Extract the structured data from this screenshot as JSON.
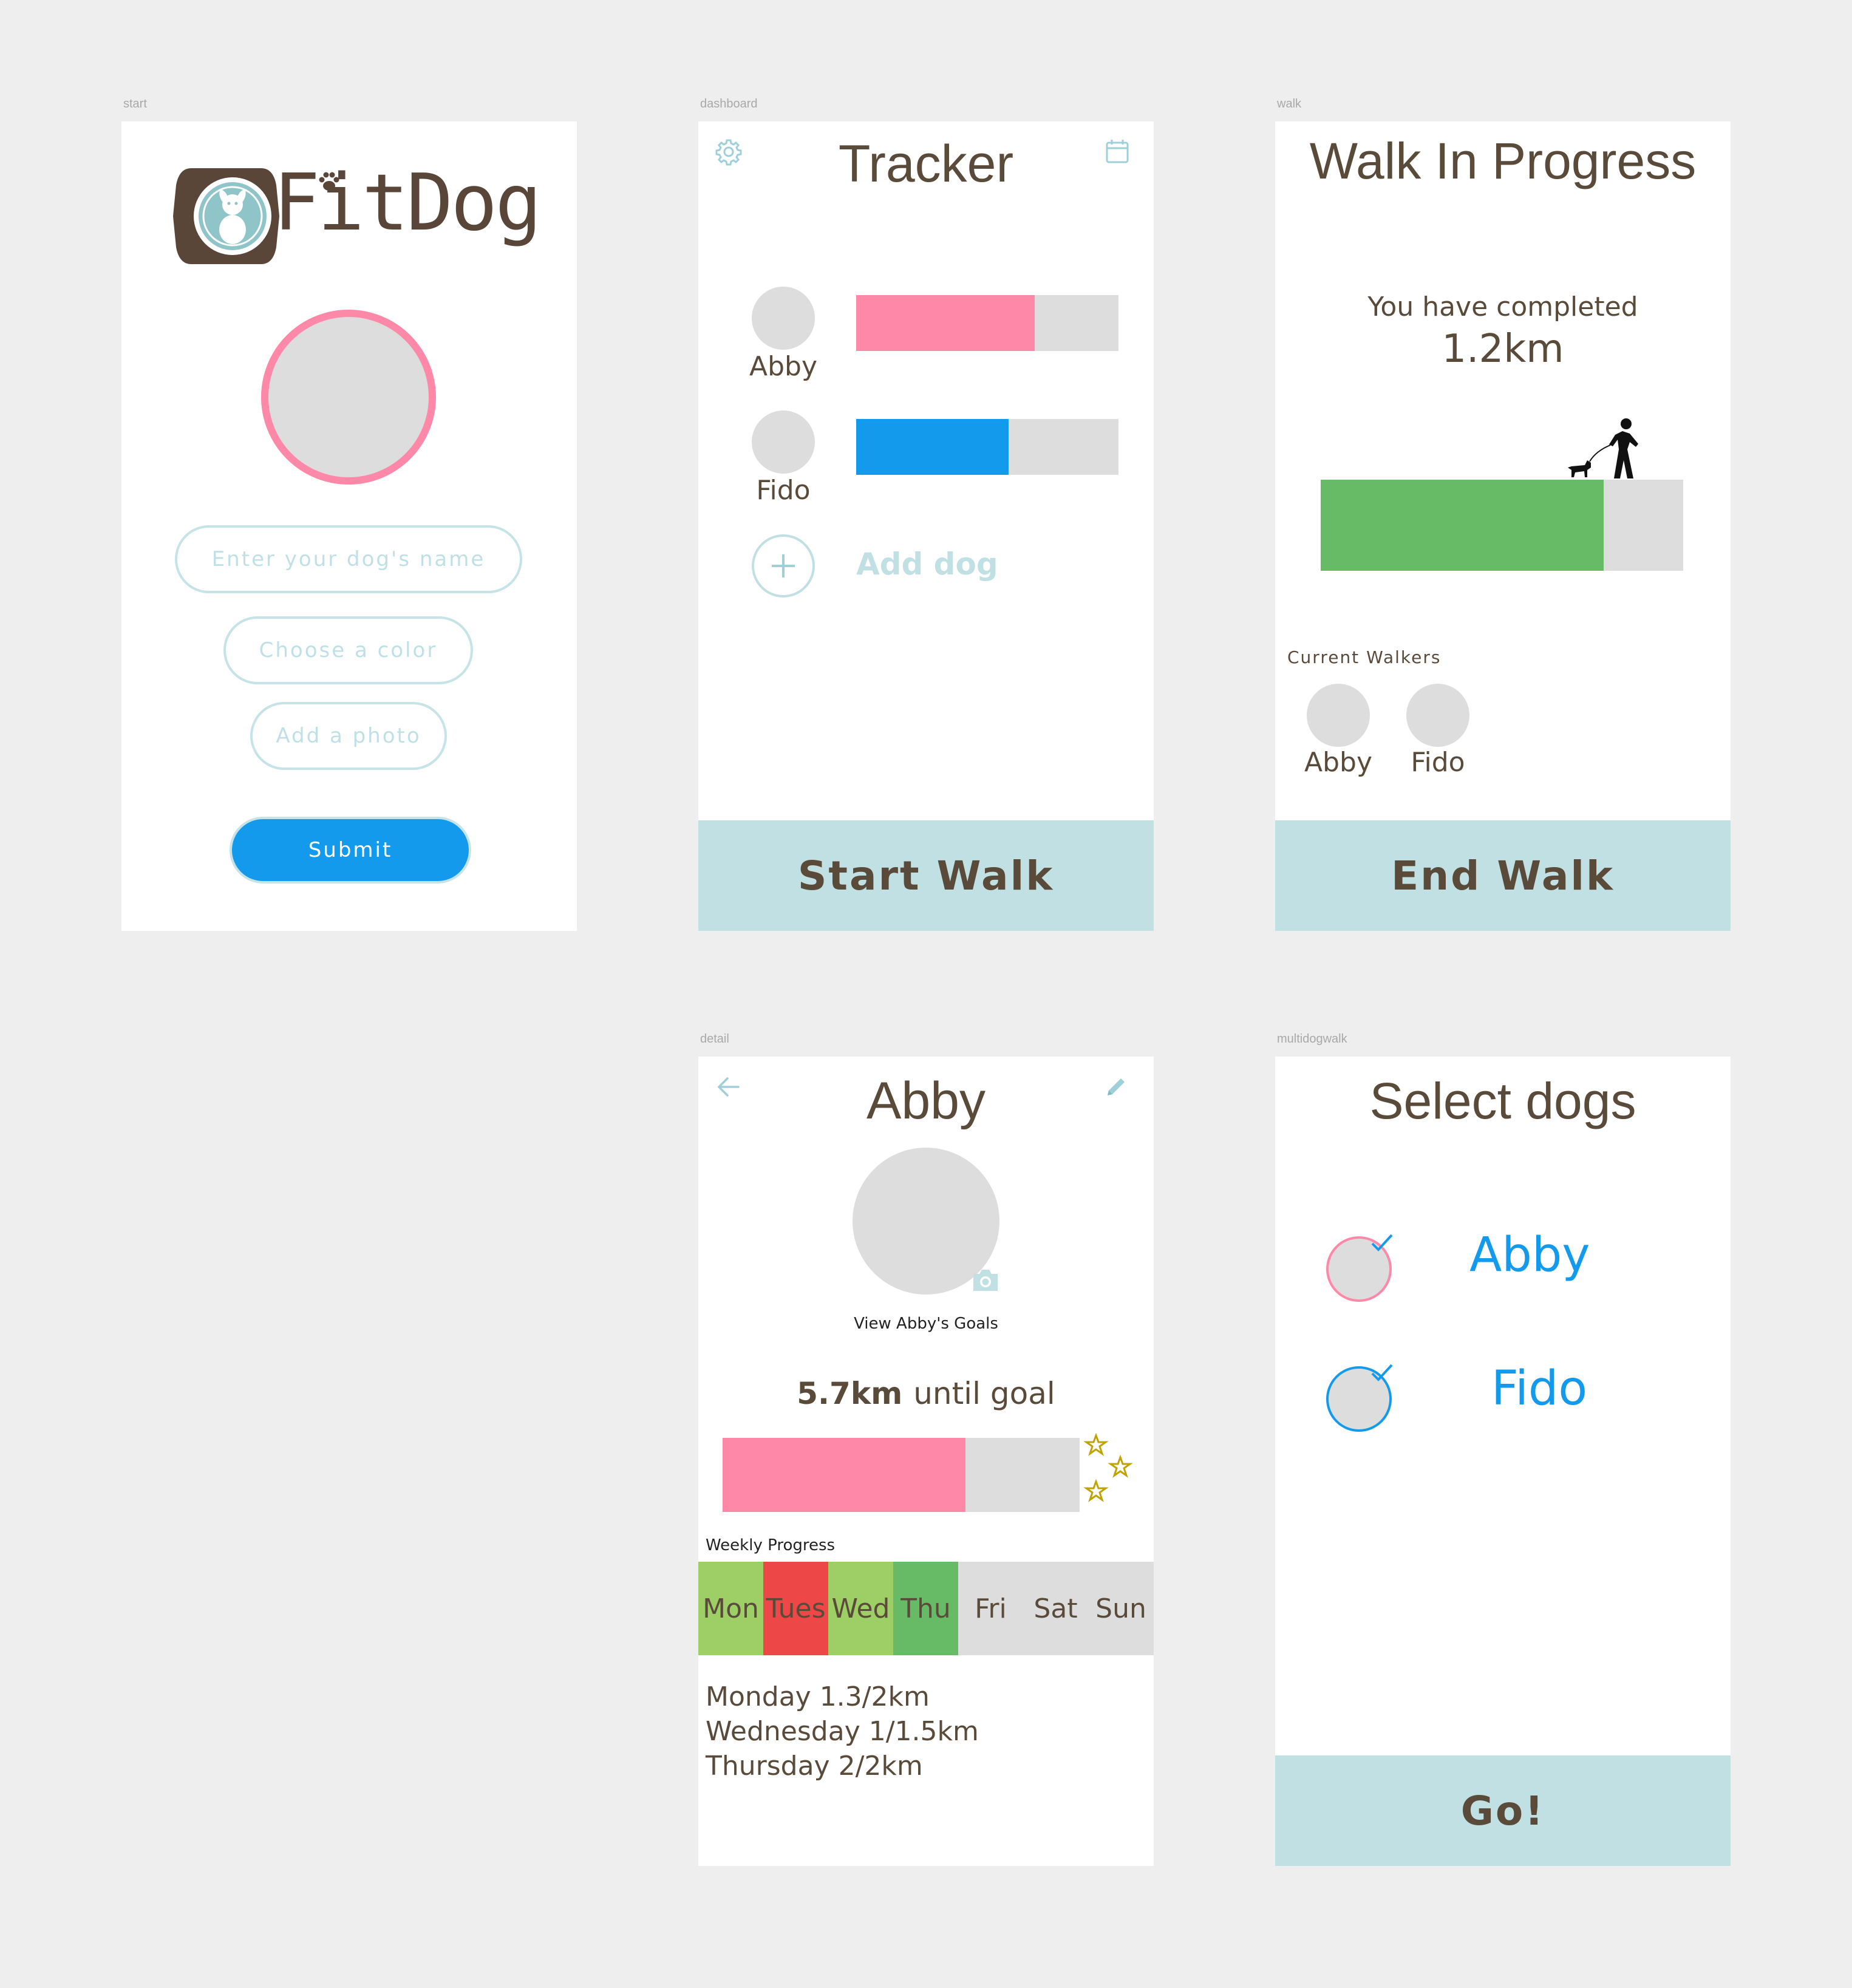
{
  "artboard_labels": {
    "start": "start",
    "dashboard": "dashboard",
    "walk": "walk",
    "detail": "detail",
    "multidogwalk": "multidogwalk"
  },
  "start": {
    "logo_text": "FitDog",
    "name_placeholder": "Enter your dog's name",
    "color_button": "Choose a color",
    "photo_button": "Add a photo",
    "submit_button": "Submit"
  },
  "dashboard": {
    "title": "Tracker",
    "dogs": [
      {
        "name": "Abby",
        "progress": 0.68,
        "color": "#fe88a8"
      },
      {
        "name": "Fido",
        "progress": 0.58,
        "color": "#149aed"
      }
    ],
    "add_dog": "Add dog",
    "start_walk": "Start Walk",
    "icons": {
      "left": "gear-icon",
      "right": "calendar-icon",
      "add": "plus-icon"
    }
  },
  "walk": {
    "title": "Walk In Progress",
    "completed_label": "You have completed",
    "distance": "1.2km",
    "progress": 0.78,
    "progress_color": "#67bb66",
    "current_walkers_label": "Current Walkers",
    "walkers": [
      "Abby",
      "Fido"
    ],
    "end_walk": "End Walk",
    "icons": {
      "walker": "person-walking-dog-icon"
    }
  },
  "detail": {
    "title": "Abby",
    "view_goals": "View Abby's Goals",
    "until_goal_value": "5.7km",
    "until_goal_text": "until goal",
    "goal_progress": 0.68,
    "goal_color": "#fe88a8",
    "weekly_progress_label": "Weekly Progress",
    "days": [
      {
        "label": "Mon",
        "color": "#9dcf66"
      },
      {
        "label": "Tues",
        "color": "#ee4747"
      },
      {
        "label": "Wed",
        "color": "#9dcf66"
      },
      {
        "label": "Thu",
        "color": "#67bb66"
      },
      {
        "label": "Fri",
        "color": "#dddddd"
      },
      {
        "label": "Sat",
        "color": "#dddddd"
      },
      {
        "label": "Sun",
        "color": "#dddddd"
      }
    ],
    "log": [
      "Monday 1.3/2km",
      "Wednesday 1/1.5km",
      "Thursday 2/2km"
    ],
    "icons": {
      "back": "arrow-left-icon",
      "edit": "pencil-icon",
      "camera": "camera-icon",
      "stars": "star-icon"
    }
  },
  "multidogwalk": {
    "title": "Select dogs",
    "dogs": [
      {
        "name": "Abby",
        "ring_color": "#fe88a8",
        "checked": true
      },
      {
        "name": "Fido",
        "ring_color": "#149aed",
        "checked": true
      }
    ],
    "go_button": "Go!"
  },
  "colors": {
    "background": "#eeeeee",
    "text_brown": "#5a4a3a",
    "accent_light_blue": "#c1e0e4",
    "accent_blue": "#149aed",
    "accent_pink": "#fe88a8",
    "green": "#67bb66"
  }
}
